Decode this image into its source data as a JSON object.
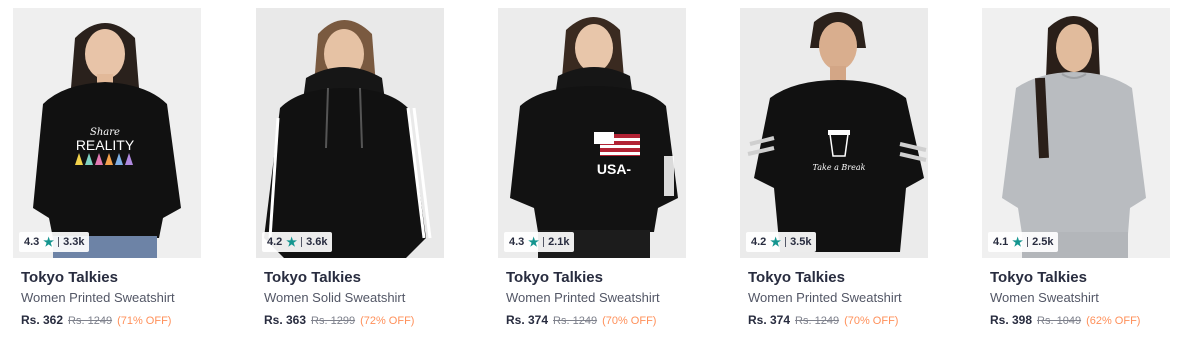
{
  "colors": {
    "star": "#14958f",
    "discount": "#ff905a",
    "brand_text": "#282c3f"
  },
  "products": [
    {
      "brand": "Tokyo Talkies",
      "name": "Women Printed Sweatshirt",
      "rating": "4.3",
      "rating_count": "3.3k",
      "price": "Rs. 362",
      "mrp": "Rs. 1249",
      "discount": "(71% OFF)",
      "print_text_1": "Share",
      "print_text_2": "REALITY",
      "image_icon": "woman-black-printed-sweatshirt-image"
    },
    {
      "brand": "Tokyo Talkies",
      "name": "Women Solid Sweatshirt",
      "rating": "4.2",
      "rating_count": "3.6k",
      "price": "Rs. 363",
      "mrp": "Rs. 1299",
      "discount": "(72% OFF)",
      "image_icon": "woman-black-hoodie-image"
    },
    {
      "brand": "Tokyo Talkies",
      "name": "Women Printed Sweatshirt",
      "rating": "4.3",
      "rating_count": "2.1k",
      "price": "Rs. 374",
      "mrp": "Rs. 1249",
      "discount": "(70% OFF)",
      "print_text_1": "USA-",
      "image_icon": "woman-black-usa-hoodie-image"
    },
    {
      "brand": "Tokyo Talkies",
      "name": "Women Printed Sweatshirt",
      "rating": "4.2",
      "rating_count": "3.5k",
      "price": "Rs. 374",
      "mrp": "Rs. 1249",
      "discount": "(70% OFF)",
      "print_text_1": "Take a Break",
      "image_icon": "woman-black-coffee-sweatshirt-image"
    },
    {
      "brand": "Tokyo Talkies",
      "name": "Women Sweatshirt",
      "rating": "4.1",
      "rating_count": "2.5k",
      "price": "Rs. 398",
      "mrp": "Rs. 1049",
      "discount": "(62% OFF)",
      "image_icon": "woman-grey-sweatshirt-image"
    }
  ]
}
